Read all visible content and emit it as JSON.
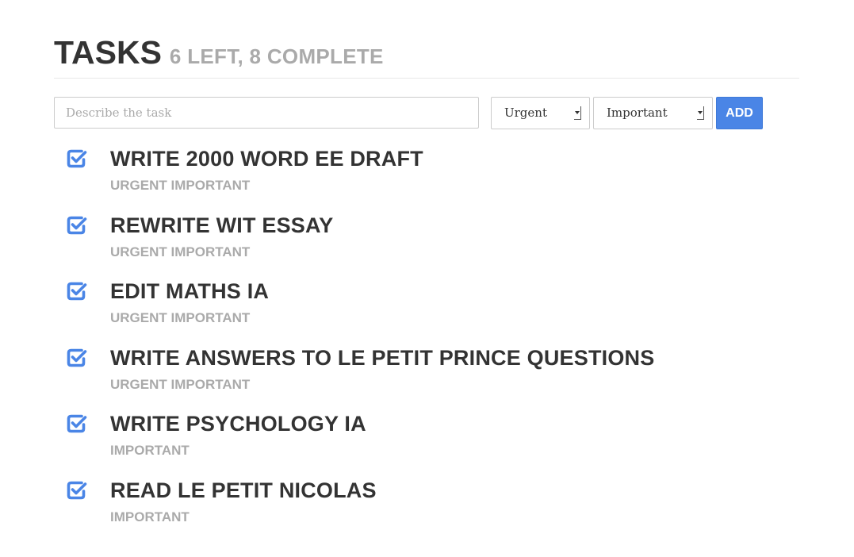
{
  "header": {
    "title": "TASKS",
    "stats": "6 LEFT, 8 COMPLETE"
  },
  "form": {
    "input_placeholder": "Describe the task",
    "input_value": "",
    "urgency_selected": "Urgent",
    "importance_selected": "Important",
    "add_label": "ADD"
  },
  "colors": {
    "accent": "#4a85e6",
    "text": "#333333",
    "muted": "#aaaaaa"
  },
  "tasks": [
    {
      "name": "WRITE 2000 WORD EE DRAFT",
      "tags": "URGENT IMPORTANT",
      "icon": "checkbox-checked-icon"
    },
    {
      "name": "REWRITE WIT ESSAY",
      "tags": "URGENT IMPORTANT",
      "icon": "checkbox-checked-icon"
    },
    {
      "name": "EDIT MATHS IA",
      "tags": "URGENT IMPORTANT",
      "icon": "checkbox-checked-icon"
    },
    {
      "name": "WRITE ANSWERS TO LE PETIT PRINCE QUESTIONS",
      "tags": "URGENT IMPORTANT",
      "icon": "checkbox-checked-icon"
    },
    {
      "name": "WRITE PSYCHOLOGY IA",
      "tags": "IMPORTANT",
      "icon": "checkbox-checked-icon"
    },
    {
      "name": "READ LE PETIT NICOLAS",
      "tags": "IMPORTANT",
      "icon": "checkbox-checked-icon"
    }
  ]
}
